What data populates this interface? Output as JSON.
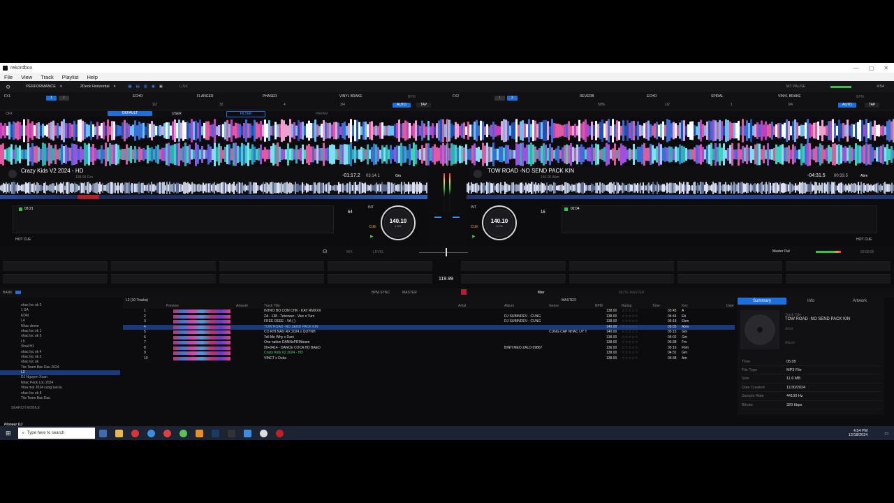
{
  "app": {
    "title": "rekordbox"
  },
  "menu": [
    "File",
    "View",
    "Track",
    "Playlist",
    "Help"
  ],
  "toolbar": {
    "mode": "PERFORMANCE",
    "layout": "2Deck Horizontal",
    "link": "LINK",
    "mt_pause": "MT PAUSE",
    "time": "4:54"
  },
  "fx1": {
    "label": "FX1",
    "effects": [
      "ECHO",
      "FLANGER",
      "PHASER",
      "VINYL BRAKE"
    ],
    "beat_values": [
      "1/2",
      "32",
      "4",
      "3/4"
    ],
    "bpm_label": "BPM",
    "auto": "AUTO",
    "tap": "TAP"
  },
  "fx2": {
    "label": "FX2",
    "effects": [
      "REVERB",
      "ECHO",
      "SPIRAL",
      "VINYL BRAKE"
    ],
    "beat_values": [
      "50%",
      "1/2",
      "1",
      "3/4"
    ],
    "bpm_label": "BPM",
    "auto": "AUTO",
    "tap": "TAP"
  },
  "cfx": {
    "label": "CFX",
    "default": "DEFAULT",
    "user": "USER",
    "filter": "FILTER",
    "param": "PARAM"
  },
  "deck1": {
    "title": "Crazy Kids V2 2024 - HD",
    "sub": "138.00 Gm",
    "remain": "-01:17.2",
    "elapsed": "03:14.1",
    "key": "Gm",
    "bpm": "140.10",
    "pitch": "1.5%",
    "beat": "64",
    "cue_time": "03:21",
    "hot_cue": "HOT CUE",
    "int": "INT",
    "cue": "CUE"
  },
  "deck2": {
    "title": "TOW ROAD -NO SEND PACK KIN",
    "sub": "140.00 Abm",
    "remain": "-04:31.5",
    "elapsed": "00:33.5",
    "key": "Abm",
    "bpm": "140.10",
    "pitch": "0.1%",
    "beat": "16",
    "cue_time": "02:04",
    "hot_cue": "HOT CUE",
    "int": "INT",
    "cue": "CUE"
  },
  "mixer": {
    "master_out": "Master Out",
    "level": "LEVEL",
    "mix": "MIX",
    "master_bpm": "119.99",
    "rec_time": "00:00:00"
  },
  "sampler_bar": {
    "bank": "BANK",
    "bpm_sync": "BPM SYNC",
    "master": "MASTER",
    "filter": "filter",
    "mute": "MUTE MASTER"
  },
  "browser": {
    "playlist_name": "L2 (10 Tracks)",
    "columns": [
      "Preview",
      "Artwork",
      "Track Title",
      "Artist",
      "Album",
      "Genre",
      "BPM",
      "Rating",
      "Time",
      "Key",
      "Date"
    ],
    "master_label": "MASTER",
    "tracks": [
      {
        "num": "1",
        "title": "INTRO BO CON CHK - KAY RMXXX",
        "artist": "",
        "album": "",
        "genre": "",
        "bpm": "138.00",
        "time": "03:45",
        "key": "A"
      },
      {
        "num": "2",
        "title": "ZA - 138 - Tetvower - Viec x Turc",
        "artist": "",
        "album": "DJ SUBINDEV - CUNG",
        "genre": "",
        "bpm": "138.00",
        "time": "04:44",
        "key": "Eb"
      },
      {
        "num": "3",
        "title": "FREE DEEE - VA ( )",
        "artist": "",
        "album": "DJ SUBINDEV - CUNG",
        "genre": "",
        "bpm": "138.00",
        "time": "05:18",
        "key": "Ebm"
      },
      {
        "num": "4",
        "title": "TOW ROAD -NO SEND PACK KIN",
        "artist": "",
        "album": "",
        "genre": "",
        "bpm": "140.00",
        "time": "05:05",
        "key": "Abm",
        "selected": true
      },
      {
        "num": "5",
        "title": "CO KHI NAO RX 2024 x QUYNH",
        "artist": "",
        "album": "",
        "genre": "CUNG CAP NHAC UY T",
        "bpm": "140.00",
        "time": "05:15",
        "key": "Gm"
      },
      {
        "num": "6",
        "title": "Tell Me Why x Dani",
        "artist": "",
        "album": "",
        "genre": "",
        "bpm": "138.00",
        "time": "05:02",
        "key": "Gm"
      },
      {
        "num": "7",
        "title": "One nation DANNxPRINteam",
        "artist": "",
        "album": "",
        "genre": "",
        "bpm": "138.00",
        "time": "05:38",
        "key": "Fm"
      },
      {
        "num": "8",
        "title": "00+0414 - DANCE COCA HD BAED",
        "artist": "",
        "album": "BINH MEO ZALO 09867",
        "genre": "",
        "bpm": "136.00",
        "time": "05:16",
        "key": "Fbm"
      },
      {
        "num": "9",
        "title": "Crazy Kids V2 2024 - HD",
        "artist": "",
        "album": "",
        "genre": "",
        "bpm": "138.00",
        "time": "04:31",
        "key": "Gm",
        "loaded": true
      },
      {
        "num": "10",
        "title": "VINCT x Duka",
        "artist": "",
        "album": "",
        "genre": "",
        "bpm": "138.00",
        "time": "05:38",
        "key": "Am"
      }
    ]
  },
  "tree": [
    "nhac loc ok 3",
    "1 SA",
    "EDM",
    "L4",
    "Nhac demo",
    "nhac loc ok 1",
    "nhac loc ok 5",
    "L5",
    "Vinal H1",
    "nhac loc ok 4",
    "nhac loc ok 2",
    "nhac loc ok",
    "Tits Team Bac Dau 2024",
    "L2",
    "DJ Nguyen Xoan",
    "Nhac Pack Loc 2024",
    "Vina moi 2024 cung tuoi lu",
    "nhac loc ok 8",
    "Tits Team Bac Dau"
  ],
  "tree_search": "SEARCH MOBILE",
  "summary": {
    "tabs": [
      "Summary",
      "Info",
      "Artwork"
    ],
    "track_title_label": "Track Title",
    "track_title": "TOW ROAD -NO SEND PACK KIN",
    "artist_label": "Artist",
    "album_label": "Album",
    "rows": [
      {
        "k": "Time",
        "v": "05:05"
      },
      {
        "k": "File Type",
        "v": "MP3 File"
      },
      {
        "k": "Size",
        "v": "11.6 MB"
      },
      {
        "k": "Date Created",
        "v": "11/30/2024"
      },
      {
        "k": "Sample Rate",
        "v": "44100 Hz"
      },
      {
        "k": "Bitrate",
        "v": "320 kbps"
      }
    ]
  },
  "taskbar": {
    "search": "Type here to search",
    "time": "4:54 PM",
    "date": "12/18/2024",
    "brand": "Pioneer DJ"
  },
  "colors": {
    "accent": "#1e6fd9",
    "selected_row": "#1a3a7a",
    "loaded": "#4cd964"
  }
}
